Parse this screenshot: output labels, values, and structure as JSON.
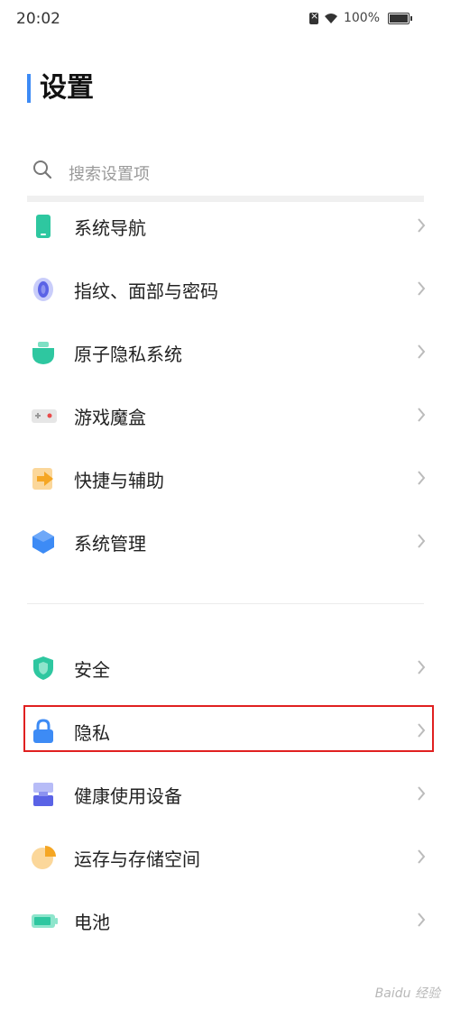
{
  "status": {
    "time": "20:02",
    "battery": "100%"
  },
  "title": "设置",
  "search": {
    "placeholder": "搜索设置项"
  },
  "group1": [
    {
      "label": "系统导航",
      "icon": "phone-icon"
    },
    {
      "label": "指纹、面部与密码",
      "icon": "fingerprint-icon"
    },
    {
      "label": "原子隐私系统",
      "icon": "atom-privacy-icon"
    },
    {
      "label": "游戏魔盒",
      "icon": "gamepad-icon"
    },
    {
      "label": "快捷与辅助",
      "icon": "shortcut-arrow-icon"
    },
    {
      "label": "系统管理",
      "icon": "hexagon-icon"
    }
  ],
  "group2": [
    {
      "label": "安全",
      "icon": "shield-icon"
    },
    {
      "label": "隐私",
      "icon": "lock-icon"
    },
    {
      "label": "健康使用设备",
      "icon": "hourglass-icon"
    },
    {
      "label": "运存与存储空间",
      "icon": "storage-pie-icon"
    },
    {
      "label": "电池",
      "icon": "battery-icon"
    }
  ],
  "watermark": "Baidu 经验"
}
